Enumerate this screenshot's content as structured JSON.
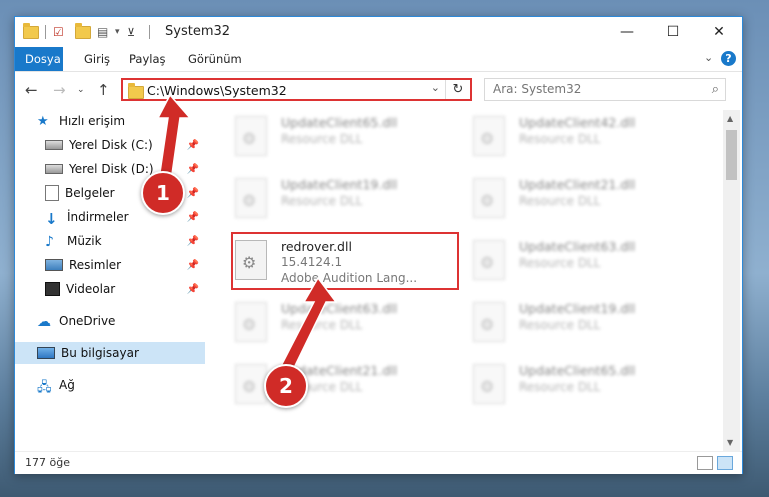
{
  "window": {
    "title": "System32"
  },
  "ribbon": {
    "tabs": [
      "Dosya",
      "Giriş",
      "Paylaş",
      "Görünüm"
    ]
  },
  "address": {
    "path": "C:\\Windows\\System32"
  },
  "search": {
    "placeholder": "Ara: System32"
  },
  "sidebar": {
    "items": [
      {
        "label": "Hızlı erişim",
        "icon": "star-icon"
      },
      {
        "label": "Yerel Disk (C:)",
        "icon": "drive-icon"
      },
      {
        "label": "Yerel Disk (D:)",
        "icon": "drive-icon"
      },
      {
        "label": "Belgeler",
        "icon": "documents-icon"
      },
      {
        "label": "İndirmeler",
        "icon": "download-icon"
      },
      {
        "label": "Müzik",
        "icon": "music-icon"
      },
      {
        "label": "Resimler",
        "icon": "pictures-icon"
      },
      {
        "label": "Videolar",
        "icon": "videos-icon"
      },
      {
        "label": "OneDrive",
        "icon": "cloud-icon"
      },
      {
        "label": "Bu bilgisayar",
        "icon": "computer-icon"
      },
      {
        "label": "Ağ",
        "icon": "network-icon"
      }
    ]
  },
  "files": [
    {
      "name": "UpdateClient65.dll",
      "desc": "Resource DLL"
    },
    {
      "name": "UpdateClient42.dll",
      "desc": "Resource DLL"
    },
    {
      "name": "UpdateClient19.dll",
      "desc": "Resource DLL"
    },
    {
      "name": "UpdateClient21.dll",
      "desc": "Resource DLL"
    },
    {
      "name": "redrover.dll",
      "version": "15.4124.1",
      "desc": "Adobe Audition Lang..."
    },
    {
      "name": "UpdateClient63.dll",
      "desc": "Resource DLL"
    },
    {
      "name": "UpdateClient63.dll",
      "desc": "Resource DLL"
    },
    {
      "name": "UpdateClient19.dll",
      "desc": "Resource DLL"
    },
    {
      "name": "UpdateClient21.dll",
      "desc": "Resource DLL"
    },
    {
      "name": "UpdateClient65.dll",
      "desc": "Resource DLL"
    }
  ],
  "status": {
    "count": "177 öğe"
  },
  "annotations": {
    "step1": "1",
    "step2": "2"
  },
  "colors": {
    "accent": "#1979ca",
    "highlight": "#d33333",
    "badge": "#d02b27"
  }
}
